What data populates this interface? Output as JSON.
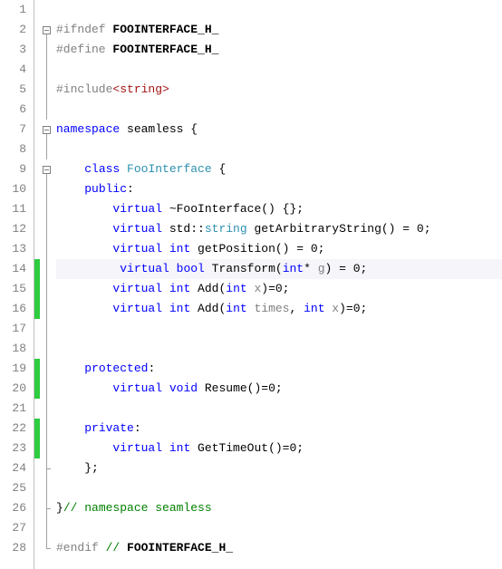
{
  "lines": {
    "l1": "",
    "l2_pp": "#ifndef",
    "l2_name": "FOOINTERFACE_H_",
    "l3_pp": "#define",
    "l3_name": "FOOINTERFACE_H_",
    "l4": "",
    "l5_pp": "#include",
    "l5_inc": "<string>",
    "l6": "",
    "l7_kw": "namespace",
    "l7_name": "seamless",
    "l7_brace": " {",
    "l8": "",
    "l9_kw": "class",
    "l9_name": "FooInterface",
    "l9_brace": " {",
    "l10_kw": "public",
    "l10_colon": ":",
    "l11_virtual": "virtual",
    "l11_dtor": " ~FooInterface() {};",
    "l12_virtual": "virtual",
    "l12_std": " std::",
    "l12_string": "string",
    "l12_rest": " getArbitraryString() = 0;",
    "l13_virtual": "virtual",
    "l13_int": "int",
    "l13_rest": " getPosition() = 0;",
    "l14_virtual": "virtual",
    "l14_bool": "bool",
    "l14_fn": " Transform(",
    "l14_ptype": "int",
    "l14_star": "*",
    "l14_pname": " g",
    "l14_end": ") = 0;",
    "l15_virtual": "virtual",
    "l15_int": "int",
    "l15_fn": " Add(",
    "l15_ptype": "int",
    "l15_pname": " x",
    "l15_end": ")=0;",
    "l16_virtual": "virtual",
    "l16_int": "int",
    "l16_fn": " Add(",
    "l16_ptype1": "int",
    "l16_pname1": " times",
    "l16_comma": ", ",
    "l16_ptype2": "int",
    "l16_pname2": " x",
    "l16_end": ")=0;",
    "l17": "",
    "l18": "",
    "l19_kw": "protected",
    "l19_colon": ":",
    "l20_virtual": "virtual",
    "l20_void": "void",
    "l20_rest": " Resume()=0;",
    "l21": "",
    "l22_kw": "private",
    "l22_colon": ":",
    "l23_virtual": "virtual",
    "l23_int": "int",
    "l23_rest": " GetTimeOut()=0;",
    "l24_brace": "};",
    "l25": "",
    "l26_brace": "}",
    "l26_comment": "// namespace seamless",
    "l27": "",
    "l28_pp": "#endif",
    "l28_comment": " // ",
    "l28_name": "FOOINTERFACE_H_"
  },
  "line_numbers": [
    "1",
    "2",
    "3",
    "4",
    "5",
    "6",
    "7",
    "8",
    "9",
    "10",
    "11",
    "12",
    "13",
    "14",
    "15",
    "16",
    "17",
    "18",
    "19",
    "20",
    "21",
    "22",
    "23",
    "24",
    "25",
    "26",
    "27",
    "28"
  ],
  "change_markers": [
    14,
    15,
    16,
    19,
    20,
    22,
    23
  ],
  "current_line": 14,
  "fold": {
    "box_lines": [
      2,
      7,
      9
    ],
    "end_lines": [
      24,
      26,
      28
    ]
  }
}
